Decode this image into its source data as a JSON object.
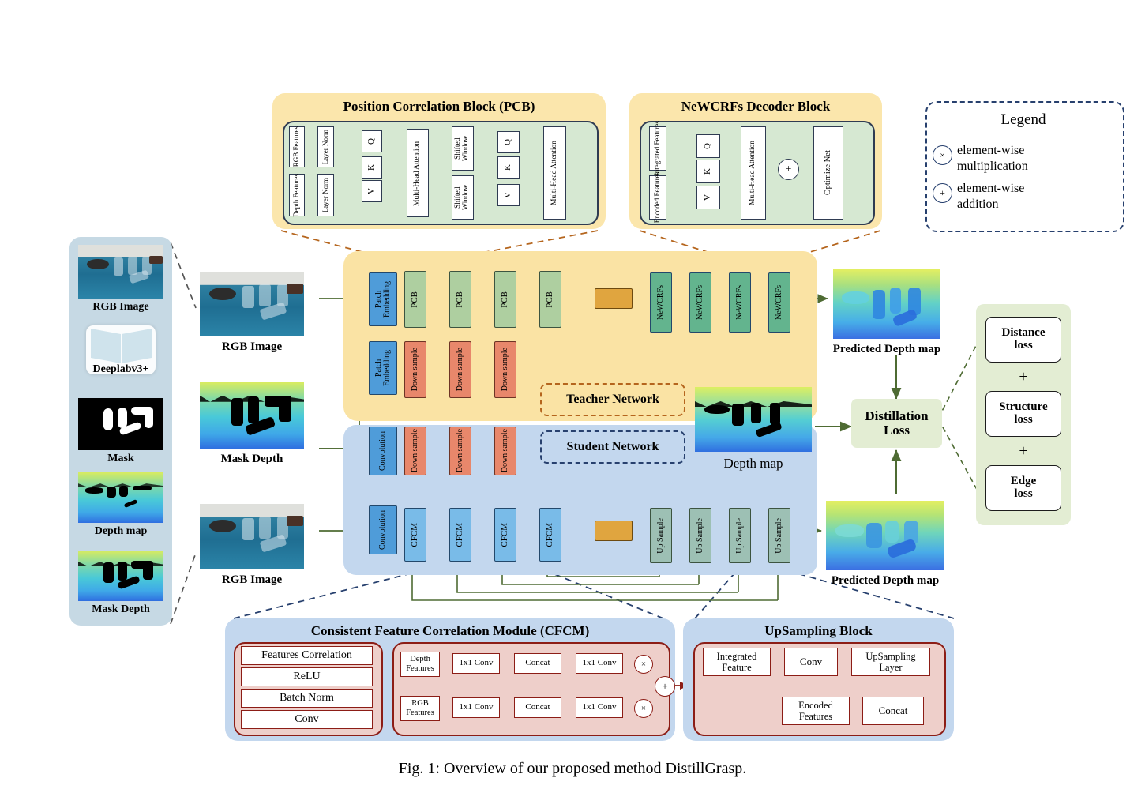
{
  "caption": "Fig. 1: Overview of our proposed method DistillGrasp.",
  "legend": {
    "title": "Legend",
    "items": [
      {
        "symbol": "×",
        "line1": "element-wise",
        "line2": "multiplication",
        "icon": "times-circle-icon"
      },
      {
        "symbol": "+",
        "line1": "element-wise",
        "line2": "addition",
        "icon": "plus-circle-icon"
      }
    ]
  },
  "sidebar": {
    "steps": [
      {
        "label": "RGB Image",
        "kind": "image-rgb"
      },
      {
        "label": "Deeplabv3+",
        "kind": "model-icon"
      },
      {
        "label": "Mask",
        "kind": "image-mask"
      },
      {
        "label": "Depth map",
        "kind": "image-depth-holes"
      },
      {
        "label": "Mask Depth",
        "kind": "image-maskdepth"
      }
    ]
  },
  "inputs": [
    {
      "label": "RGB Image"
    },
    {
      "label": "Mask Depth"
    },
    {
      "label": "RGB Image"
    }
  ],
  "pcb_panel": {
    "title": "Position Correlation Block (PCB)",
    "nodes": [
      "RGB Features",
      "Depth Features",
      "Layer Norm",
      "Layer Norm",
      "Q",
      "K",
      "V",
      "Multi-Head Attention",
      "Shifted Window",
      "Shifted Window",
      "Q",
      "K",
      "V",
      "Multi-Head Attention"
    ]
  },
  "newcrfs_panel": {
    "title": "NeWCRFs Decoder Block",
    "nodes": [
      "Integrated Features",
      "Encoded Features",
      "Q",
      "K",
      "V",
      "Multi-Head Attention",
      "Optimize Net"
    ],
    "op": "+"
  },
  "teacher": {
    "badge": "Teacher Network",
    "top_row": [
      "Patch Embedding",
      "PCB",
      "PCB",
      "PCB",
      "PCB"
    ],
    "bottleneck": "",
    "decoder": [
      "NeWCRFs",
      "NeWCRFs",
      "NeWCRFs",
      "NeWCRFs"
    ],
    "bottom_row": [
      "Patch Embedding",
      "Down sample",
      "Down sample",
      "Down sample"
    ]
  },
  "student": {
    "badge": "Student Network",
    "top_row": [
      "Convolution",
      "Down sample",
      "Down sample",
      "Down sample"
    ],
    "bottom_row": [
      "Convolution",
      "CFCM",
      "CFCM",
      "CFCM",
      "CFCM"
    ],
    "bottleneck": "",
    "decoder": [
      "Up Sample",
      "Up Sample",
      "Up Sample",
      "Up Sample"
    ]
  },
  "outputs": {
    "teacher_pred": "Predicted Depth map",
    "teacher_depth": "Depth map",
    "student_pred": "Predicted Depth map"
  },
  "distillation": {
    "line1": "Distillation",
    "line2": "Loss"
  },
  "losses": {
    "items": [
      "Distance loss",
      "Structure loss",
      "Edge loss"
    ],
    "operator": "+"
  },
  "cfcm_panel": {
    "title": "Consistent Feature Correlation Module (CFCM)",
    "stack": [
      "Features Correlation",
      "ReLU",
      "Batch Norm",
      "Conv"
    ],
    "flow": {
      "inputs": [
        "Depth Features",
        "RGB Features"
      ],
      "conv1": "1x1 Conv",
      "concat": "Concat",
      "conv2": "1x1 Conv",
      "mul": "×",
      "add": "+"
    }
  },
  "upsample_panel": {
    "title": "UpSampling Block",
    "nodes": [
      "Integrated Feature",
      "Conv",
      "UpSampling Layer",
      "Encoded Features",
      "Concat"
    ]
  },
  "colors": {
    "teacher_panel": "#fbe6ac",
    "student_panel": "#c3d7ee",
    "pcb_block": "#aecfa0",
    "downsample_block": "#e8876b",
    "newcrfs_block": "#63b48e",
    "patch_embedding": "#4f9cd9",
    "cfcm_block": "#79bbe8",
    "upsample_block": "#9dc0b4",
    "bottleneck": "#e0a53f",
    "arrow": "#4e6b33",
    "cfcm_arrow": "#8c1d16",
    "loss_panel": "#e3edd3"
  }
}
